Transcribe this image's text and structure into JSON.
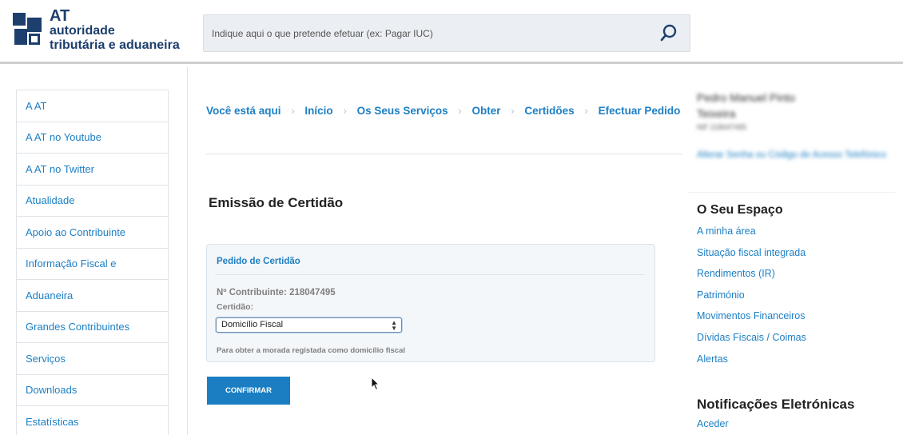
{
  "header": {
    "logo": {
      "line1": "AT",
      "line2": "autoridade",
      "line3": "tributária e aduaneira"
    },
    "search": {
      "placeholder": "Indique aqui o que pretende efetuar (ex: Pagar IUC)",
      "value": "",
      "icon": "search-icon"
    }
  },
  "left_nav": {
    "items": [
      {
        "label": "A AT"
      },
      {
        "label": "A AT no Youtube"
      },
      {
        "label": "A AT no Twitter"
      },
      {
        "label": "Atualidade"
      },
      {
        "label": "Apoio ao Contribuinte"
      },
      {
        "label": "Informação Fiscal e"
      },
      {
        "label": "Aduaneira"
      },
      {
        "label": "Grandes Contribuintes"
      },
      {
        "label": "Serviços"
      },
      {
        "label": "Downloads"
      },
      {
        "label": "Estatísticas"
      }
    ]
  },
  "breadcrumb": {
    "intro": "Você está aqui",
    "items": [
      {
        "label": "Início"
      },
      {
        "label": "Os Seus Serviços"
      },
      {
        "label": "Obter"
      },
      {
        "label": "Certidões"
      },
      {
        "label": "Efectuar Pedido"
      }
    ],
    "separator": "›"
  },
  "main": {
    "title": "Emissão de Certidão",
    "panel": {
      "title": "Pedido de Certidão",
      "nif_line": "Nº Contribuinte: 218047495",
      "select_label": "Certidão:",
      "select_value": "Domicílio Fiscal",
      "hint": "Para obter a morada registada como domicílio fiscal"
    },
    "confirm_label": "CONFIRMAR"
  },
  "right": {
    "user_name": "Pedro Manuel Pinto Teixeira",
    "user_id": "NIF 218047495",
    "user_link": "Alterar Senha ou Código de Acesso Telefónico",
    "espaco": {
      "title": "O Seu Espaço",
      "links": [
        {
          "label": "A minha área"
        },
        {
          "label": "Situação fiscal integrada"
        },
        {
          "label": "Rendimentos (IR)"
        },
        {
          "label": "Património"
        },
        {
          "label": "Movimentos Financeiros"
        },
        {
          "label": "Dívidas Fiscais / Coimas"
        },
        {
          "label": "Alertas"
        }
      ]
    },
    "notificacoes": {
      "title": "Notificações Eletrónicas",
      "links": [
        {
          "label": "Aceder"
        }
      ]
    }
  },
  "colors": {
    "link": "#1d7fc4",
    "brand": "#1d3f6d",
    "button": "#1b7ec2"
  }
}
